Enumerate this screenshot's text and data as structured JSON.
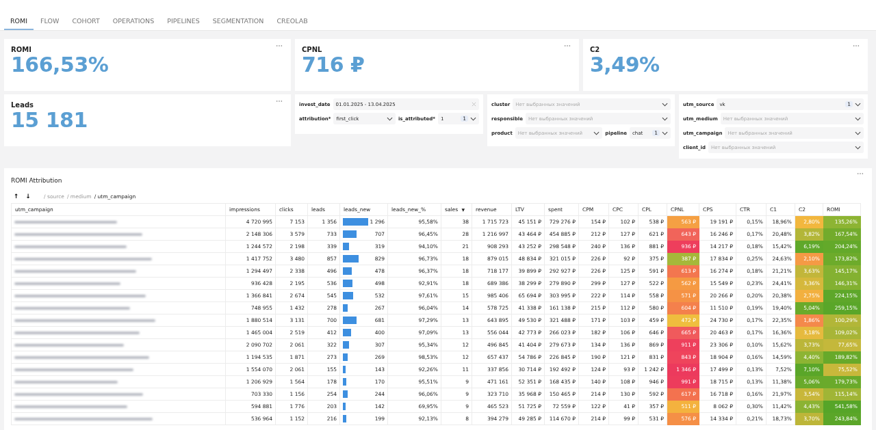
{
  "tabs": [
    {
      "label": "ROMI",
      "selected": true
    },
    {
      "label": "FLOW",
      "selected": false
    },
    {
      "label": "COHORT",
      "selected": false
    },
    {
      "label": "OPERATIONS",
      "selected": false
    },
    {
      "label": "PIPELINES",
      "selected": false
    },
    {
      "label": "SEGMENTATION",
      "selected": false
    },
    {
      "label": "CREOLAB",
      "selected": false
    }
  ],
  "kpi_cards": [
    {
      "title": "ROMI",
      "value": "166,53%"
    },
    {
      "title": "CPNL",
      "value": "716 ₽"
    },
    {
      "title": "C2",
      "value": "3,49%"
    },
    {
      "title": "Leads",
      "value": "15 181"
    }
  ],
  "filter_panels": [
    {
      "rows": [
        [
          {
            "kind": "date",
            "label": "invest_date",
            "value": "01.01.2025 - 13.04.2025"
          }
        ],
        [
          {
            "kind": "select",
            "label": "attribution*",
            "value": "first_click"
          },
          {
            "kind": "select",
            "label": "is_attributed*",
            "value": "1",
            "count": "1"
          }
        ]
      ]
    },
    {
      "rows": [
        [
          {
            "kind": "select",
            "label": "cluster",
            "placeholder": "Нет выбранных значений"
          }
        ],
        [
          {
            "kind": "select",
            "label": "responsible",
            "placeholder": "Нет выбранных значений"
          }
        ],
        [
          {
            "kind": "select",
            "label": "product",
            "placeholder": "Нет выбранных значений"
          },
          {
            "kind": "select",
            "label": "pipeline",
            "value": "chat",
            "count": "1"
          }
        ]
      ]
    },
    {
      "rows": [
        [
          {
            "kind": "select",
            "label": "utm_source",
            "value": "vk",
            "count": "1"
          }
        ],
        [
          {
            "kind": "select",
            "label": "utm_medium",
            "placeholder": "Нет выбранных значений"
          }
        ],
        [
          {
            "kind": "select",
            "label": "utm_campaign",
            "placeholder": "Нет выбранных значений"
          }
        ],
        [
          {
            "kind": "select",
            "label": "client_id",
            "placeholder": "Нет выбранных значений"
          }
        ]
      ]
    }
  ],
  "table": {
    "title": "ROMI Attribution",
    "sort_buttons": [
      "↑",
      "↓"
    ],
    "breadcrumb": [
      {
        "text": "/ source",
        "current": false
      },
      {
        "text": "/ medium",
        "current": false
      },
      {
        "text": "/ utm_campaign",
        "current": true
      }
    ],
    "columns": [
      {
        "label": "utm_campaign"
      },
      {
        "label": "impressions"
      },
      {
        "label": "clicks"
      },
      {
        "label": "leads"
      },
      {
        "label": "leads_new"
      },
      {
        "label": "leads_new_%"
      },
      {
        "label": "sales",
        "sort_mark": "▼"
      },
      {
        "label": "revenue"
      },
      {
        "label": "LTV"
      },
      {
        "label": "spent"
      },
      {
        "label": "CPM"
      },
      {
        "label": "CPC"
      },
      {
        "label": "CPL"
      },
      {
        "label": "CPNL"
      },
      {
        "label": "CPS"
      },
      {
        "label": "CTR"
      },
      {
        "label": "C1"
      },
      {
        "label": "C2"
      },
      {
        "label": "ROMI"
      }
    ],
    "rows": [
      {
        "cells": [
          {
            "kind": "blurred"
          },
          "4 720 995",
          "7 153",
          "1 356",
          {
            "kind": "bar",
            "text": "1 296",
            "level": 0.6
          },
          "95,58%",
          "38",
          "1 715 723",
          "45 151 ₽",
          "729 276 ₽",
          "154 ₽",
          "102 ₽",
          "538 ₽",
          {
            "kind": "heat",
            "text": "563 ₽",
            "color": "#f5a043"
          },
          "19 191 ₽",
          "0,15%",
          "18,96%",
          {
            "kind": "heat",
            "text": "2,80%",
            "color": "#f2b73e"
          },
          {
            "kind": "heat",
            "text": "135,26%",
            "color": "#8db433"
          }
        ]
      },
      {
        "cells": [
          {
            "kind": "blurred"
          },
          "2 148 306",
          "3 579",
          "733",
          {
            "kind": "bar",
            "text": "707",
            "level": 0.33
          },
          "96,45%",
          "28",
          "1 216 997",
          "43 464 ₽",
          "454 885 ₽",
          "212 ₽",
          "127 ₽",
          "621 ₽",
          {
            "kind": "heat",
            "text": "643 ₽",
            "color": "#f1645a"
          },
          "16 246 ₽",
          "0,17%",
          "20,48%",
          {
            "kind": "heat",
            "text": "3,82%",
            "color": "#b3b638"
          },
          {
            "kind": "heat",
            "text": "167,54%",
            "color": "#72ab2c"
          }
        ]
      },
      {
        "cells": [
          {
            "kind": "blurred"
          },
          "1 244 572",
          "2 198",
          "339",
          {
            "kind": "bar",
            "text": "319",
            "level": 0.15
          },
          "94,10%",
          "21",
          "908 293",
          "43 252 ₽",
          "298 548 ₽",
          "240 ₽",
          "136 ₽",
          "881 ₽",
          {
            "kind": "heat",
            "text": "936 ₽",
            "color": "#ee3e5c"
          },
          "14 217 ₽",
          "0,18%",
          "15,42%",
          {
            "kind": "heat",
            "text": "6,19%",
            "color": "#5fa82a"
          },
          {
            "kind": "heat",
            "text": "204,24%",
            "color": "#63a92a"
          }
        ]
      },
      {
        "cells": [
          {
            "kind": "blurred"
          },
          "1 417 752",
          "3 480",
          "857",
          {
            "kind": "bar",
            "text": "829",
            "level": 0.38
          },
          "96,73%",
          "18",
          "879 015",
          "48 834 ₽",
          "321 015 ₽",
          "226 ₽",
          "92 ₽",
          "375 ₽",
          {
            "kind": "heat",
            "text": "387 ₽",
            "color": "#a5b83a"
          },
          "17 834 ₽",
          "0,25%",
          "24,63%",
          {
            "kind": "heat",
            "text": "2,10%",
            "color": "#f59a45"
          },
          {
            "kind": "heat",
            "text": "173,82%",
            "color": "#6dab2b"
          }
        ]
      },
      {
        "cells": [
          {
            "kind": "blurred"
          },
          "1 294 497",
          "2 338",
          "496",
          {
            "kind": "bar",
            "text": "478",
            "level": 0.22
          },
          "96,37%",
          "18",
          "718 177",
          "39 899 ₽",
          "292 927 ₽",
          "226 ₽",
          "125 ₽",
          "591 ₽",
          {
            "kind": "heat",
            "text": "613 ₽",
            "color": "#f3764f"
          },
          "16 274 ₽",
          "0,18%",
          "21,21%",
          {
            "kind": "heat",
            "text": "3,63%",
            "color": "#c2b63a"
          },
          {
            "kind": "heat",
            "text": "145,17%",
            "color": "#84b131"
          }
        ]
      },
      {
        "cells": [
          {
            "kind": "blurred"
          },
          "936 428",
          "2 195",
          "536",
          {
            "kind": "bar",
            "text": "498",
            "level": 0.23
          },
          "92,91%",
          "18",
          "689 386",
          "38 299 ₽",
          "279 890 ₽",
          "299 ₽",
          "127 ₽",
          "522 ₽",
          {
            "kind": "heat",
            "text": "562 ₽",
            "color": "#f59a42"
          },
          "15 549 ₽",
          "0,23%",
          "24,41%",
          {
            "kind": "heat",
            "text": "3,36%",
            "color": "#d5b83c"
          },
          {
            "kind": "heat",
            "text": "146,31%",
            "color": "#83b131"
          }
        ]
      },
      {
        "cells": [
          {
            "kind": "blurred"
          },
          "1 366 841",
          "2 674",
          "545",
          {
            "kind": "bar",
            "text": "532",
            "level": 0.25
          },
          "97,61%",
          "15",
          "985 406",
          "65 694 ₽",
          "303 995 ₽",
          "222 ₽",
          "114 ₽",
          "558 ₽",
          {
            "kind": "heat",
            "text": "571 ₽",
            "color": "#f59245"
          },
          "20 266 ₽",
          "0,20%",
          "20,38%",
          {
            "kind": "heat",
            "text": "2,75%",
            "color": "#f2b03f"
          },
          {
            "kind": "heat",
            "text": "224,15%",
            "color": "#5ea72a"
          }
        ]
      },
      {
        "cells": [
          {
            "kind": "blurred"
          },
          "748 955",
          "1 432",
          "278",
          {
            "kind": "bar",
            "text": "267",
            "level": 0.12
          },
          "96,04%",
          "14",
          "578 725",
          "41 338 ₽",
          "161 138 ₽",
          "215 ₽",
          "112 ₽",
          "580 ₽",
          {
            "kind": "heat",
            "text": "604 ₽",
            "color": "#f4804c"
          },
          "11 510 ₽",
          "0,19%",
          "19,40%",
          {
            "kind": "heat",
            "text": "5,04%",
            "color": "#6aaa2b"
          },
          {
            "kind": "heat",
            "text": "259,15%",
            "color": "#5aa629"
          }
        ]
      },
      {
        "cells": [
          {
            "kind": "blurred"
          },
          "1 880 514",
          "3 131",
          "700",
          {
            "kind": "bar",
            "text": "681",
            "level": 0.32
          },
          "97,29%",
          "13",
          "643 895",
          "49 530 ₽",
          "321 488 ₽",
          "171 ₽",
          "103 ₽",
          "459 ₽",
          {
            "kind": "heat",
            "text": "472 ₽",
            "color": "#efbe3e"
          },
          "24 730 ₽",
          "0,17%",
          "22,35%",
          {
            "kind": "heat",
            "text": "1,86%",
            "color": "#f4894b"
          },
          {
            "kind": "heat",
            "text": "100,29%",
            "color": "#b2b638"
          }
        ]
      },
      {
        "cells": [
          {
            "kind": "blurred"
          },
          "1 465 004",
          "2 519",
          "412",
          {
            "kind": "bar",
            "text": "400",
            "level": 0.19
          },
          "97,09%",
          "13",
          "556 044",
          "42 773 ₽",
          "266 023 ₽",
          "182 ₽",
          "106 ₽",
          "646 ₽",
          {
            "kind": "heat",
            "text": "665 ₽",
            "color": "#f05a5c"
          },
          "20 463 ₽",
          "0,17%",
          "16,36%",
          {
            "kind": "heat",
            "text": "3,18%",
            "color": "#e6ba3e"
          },
          {
            "kind": "heat",
            "text": "109,02%",
            "color": "#a8b537"
          }
        ]
      },
      {
        "cells": [
          {
            "kind": "blurred"
          },
          "2 090 702",
          "2 061",
          "322",
          {
            "kind": "bar",
            "text": "307",
            "level": 0.14
          },
          "95,34%",
          "12",
          "496 845",
          "41 404 ₽",
          "279 673 ₽",
          "134 ₽",
          "136 ₽",
          "869 ₽",
          {
            "kind": "heat",
            "text": "911 ₽",
            "color": "#ee405c"
          },
          "23 306 ₽",
          "0,10%",
          "15,62%",
          {
            "kind": "heat",
            "text": "3,73%",
            "color": "#bbb639"
          },
          {
            "kind": "heat",
            "text": "77,65%",
            "color": "#c4b83b"
          }
        ]
      },
      {
        "cells": [
          {
            "kind": "blurred"
          },
          "1 194 535",
          "1 871",
          "273",
          {
            "kind": "bar",
            "text": "269",
            "level": 0.12
          },
          "98,53%",
          "12",
          "657 437",
          "54 786 ₽",
          "226 845 ₽",
          "190 ₽",
          "121 ₽",
          "831 ₽",
          {
            "kind": "heat",
            "text": "843 ₽",
            "color": "#ef445c"
          },
          "18 904 ₽",
          "0,16%",
          "14,59%",
          {
            "kind": "heat",
            "text": "4,40%",
            "color": "#8db433"
          },
          {
            "kind": "heat",
            "text": "189,82%",
            "color": "#67a92a"
          }
        ]
      },
      {
        "cells": [
          {
            "kind": "blurred"
          },
          "1 554 070",
          "2 061",
          "155",
          {
            "kind": "bar",
            "text": "143",
            "level": 0.07
          },
          "92,26%",
          "11",
          "337 856",
          "30 714 ₽",
          "192 492 ₽",
          "124 ₽",
          "93 ₽",
          "1 242 ₽",
          {
            "kind": "heat",
            "text": "1 346 ₽",
            "color": "#ec3a5d"
          },
          "17 499 ₽",
          "0,13%",
          "7,52%",
          {
            "kind": "heat",
            "text": "7,10%",
            "color": "#5aa629"
          },
          {
            "kind": "heat",
            "text": "75,52%",
            "color": "#c8b83b"
          }
        ]
      },
      {
        "cells": [
          {
            "kind": "blurred"
          },
          "1 206 929",
          "1 564",
          "178",
          {
            "kind": "bar",
            "text": "170",
            "level": 0.08
          },
          "95,51%",
          "9",
          "471 161",
          "52 351 ₽",
          "168 435 ₽",
          "140 ₽",
          "108 ₽",
          "946 ₽",
          {
            "kind": "heat",
            "text": "991 ₽",
            "color": "#ed3c5c"
          },
          "18 715 ₽",
          "0,13%",
          "11,38%",
          {
            "kind": "heat",
            "text": "5,06%",
            "color": "#69aa2b"
          },
          {
            "kind": "heat",
            "text": "179,73%",
            "color": "#6aaa2b"
          }
        ]
      },
      {
        "cells": [
          {
            "kind": "blurred"
          },
          "703 330",
          "1 156",
          "254",
          {
            "kind": "bar",
            "text": "244",
            "level": 0.11
          },
          "96,06%",
          "9",
          "323 710",
          "35 968 ₽",
          "150 465 ₽",
          "214 ₽",
          "130 ₽",
          "592 ₽",
          {
            "kind": "heat",
            "text": "617 ₽",
            "color": "#f3724f"
          },
          "16 718 ₽",
          "0,16%",
          "21,97%",
          {
            "kind": "heat",
            "text": "3,54%",
            "color": "#c8b73a"
          },
          {
            "kind": "heat",
            "text": "115,14%",
            "color": "#a0b536"
          }
        ]
      },
      {
        "cells": [
          {
            "kind": "blurred"
          },
          "594 881",
          "1 776",
          "203",
          {
            "kind": "bar",
            "text": "142",
            "level": 0.07
          },
          "69,95%",
          "9",
          "465 523",
          "51 725 ₽",
          "72 559 ₽",
          "122 ₽",
          "41 ₽",
          "357 ₽",
          {
            "kind": "heat",
            "text": "511 ₽",
            "color": "#f4b23e"
          },
          "8 062 ₽",
          "0,30%",
          "11,42%",
          {
            "kind": "heat",
            "text": "4,43%",
            "color": "#8bb333"
          },
          {
            "kind": "heat",
            "text": "541,58%",
            "color": "#56a528"
          }
        ]
      },
      {
        "cells": [
          {
            "kind": "blurred"
          },
          "536 964",
          "1 152",
          "216",
          {
            "kind": "bar",
            "text": "199",
            "level": 0.09
          },
          "92,13%",
          "8",
          "394 279",
          "49 285 ₽",
          "114 670 ₽",
          "214 ₽",
          "99 ₽",
          "531 ₽",
          {
            "kind": "heat",
            "text": "576 ₽",
            "color": "#f58f46"
          },
          "14 334 ₽",
          "0,21%",
          "18,73%",
          {
            "kind": "heat",
            "text": "3,70%",
            "color": "#bdb639"
          },
          {
            "kind": "heat",
            "text": "243,84%",
            "color": "#5ba629"
          }
        ]
      }
    ]
  }
}
